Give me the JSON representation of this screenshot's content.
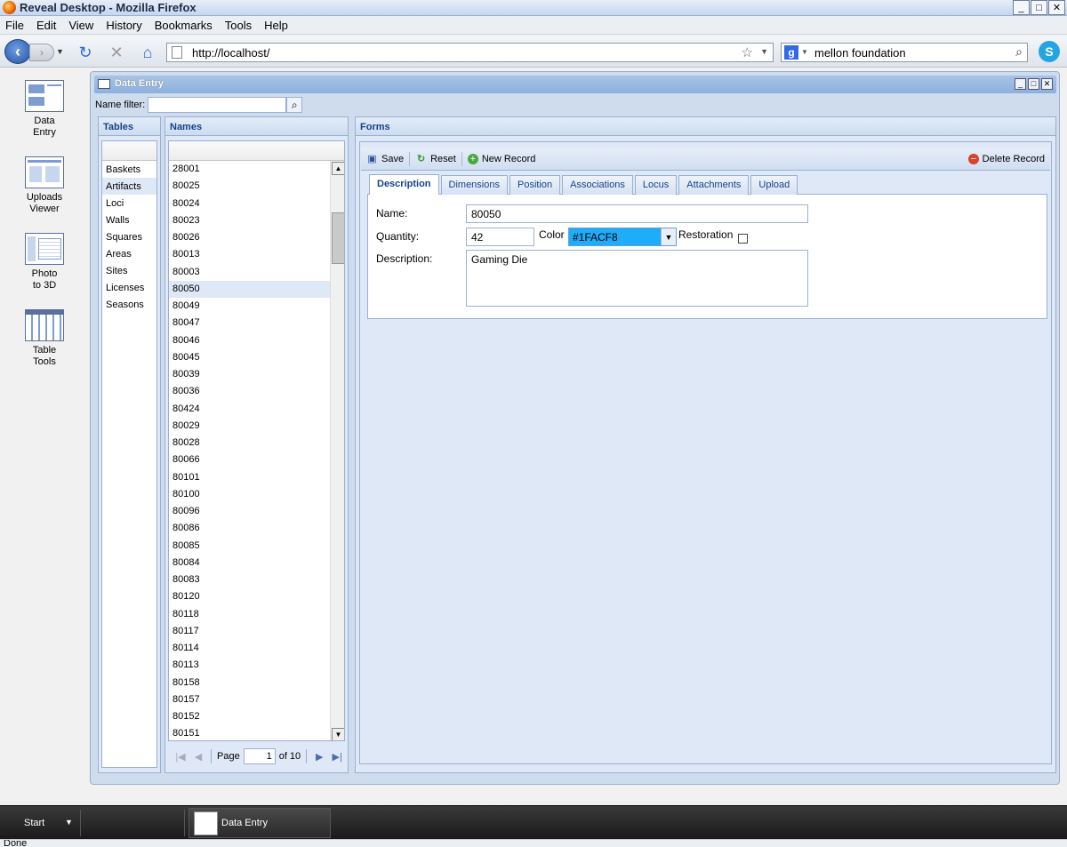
{
  "browser": {
    "title": "Reveal Desktop - Mozilla Firefox",
    "menu": [
      "File",
      "Edit",
      "View",
      "History",
      "Bookmarks",
      "Tools",
      "Help"
    ],
    "url": "http://localhost/",
    "search_text": "mellon foundation",
    "status": "Done"
  },
  "desktop_icons": [
    {
      "label_1": "Data",
      "label_2": "Entry",
      "icon": "data-entry-icon"
    },
    {
      "label_1": "Uploads",
      "label_2": "Viewer",
      "icon": "uploads-viewer-icon"
    },
    {
      "label_1": "Photo",
      "label_2": "to 3D",
      "icon": "photo-to-3d-icon"
    },
    {
      "label_1": "Table",
      "label_2": "Tools",
      "icon": "table-tools-icon"
    }
  ],
  "window": {
    "title": "Data Entry",
    "filter_label": "Name filter:",
    "filter_value": ""
  },
  "tables": {
    "title": "Tables",
    "items": [
      "Baskets",
      "Artifacts",
      "Loci",
      "Walls",
      "Squares",
      "Areas",
      "Sites",
      "Licenses",
      "Seasons"
    ],
    "selected": "Artifacts"
  },
  "names": {
    "title": "Names",
    "items": [
      "28001",
      "80025",
      "80024",
      "80023",
      "80026",
      "80013",
      "80003",
      "80050",
      "80049",
      "80047",
      "80046",
      "80045",
      "80039",
      "80036",
      "80424",
      "80029",
      "80028",
      "80066",
      "80101",
      "80100",
      "80096",
      "80086",
      "80085",
      "80084",
      "80083",
      "80120",
      "80118",
      "80117",
      "80114",
      "80113",
      "80158",
      "80157",
      "80152",
      "80151"
    ],
    "selected": "80050",
    "pager": {
      "page_label": "Page",
      "page_value": "1",
      "of_label": "of 10"
    }
  },
  "forms": {
    "title": "Forms",
    "toolbar": {
      "save": "Save",
      "reset": "Reset",
      "new_record": "New Record",
      "delete_record": "Delete Record"
    },
    "tabs": [
      "Description",
      "Dimensions",
      "Position",
      "Associations",
      "Locus",
      "Attachments",
      "Upload"
    ],
    "active_tab": "Description",
    "fields": {
      "name_label": "Name:",
      "name_value": "80050",
      "quantity_label": "Quantity:",
      "quantity_value": "42",
      "color_label": "Color",
      "color_value": "#1FACF8",
      "restoration_label": "Restoration",
      "restoration_checked": false,
      "description_label": "Description:",
      "description_value": "Gaming Die"
    }
  },
  "taskbar": {
    "start_label": "Start",
    "item_label": "Data Entry"
  },
  "colors": {
    "accent": "#15428b",
    "panel_bg": "#dfe8f6",
    "color_swatch": "#1FACF8"
  }
}
